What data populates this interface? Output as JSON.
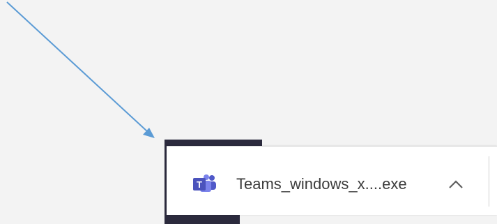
{
  "download_bar": {
    "file_name": "Teams_windows_x....exe",
    "file_icon": "teams-app-icon",
    "menu_icon": "chevron-up-icon"
  },
  "annotation": {
    "icon": "arrow-annotation",
    "color": "#5b9bd5"
  },
  "colors": {
    "teams_purple": "#5059c9",
    "teams_purple_light": "#7b83eb",
    "background": "#f3f3f3",
    "dark_window": "#2b2a3d"
  }
}
